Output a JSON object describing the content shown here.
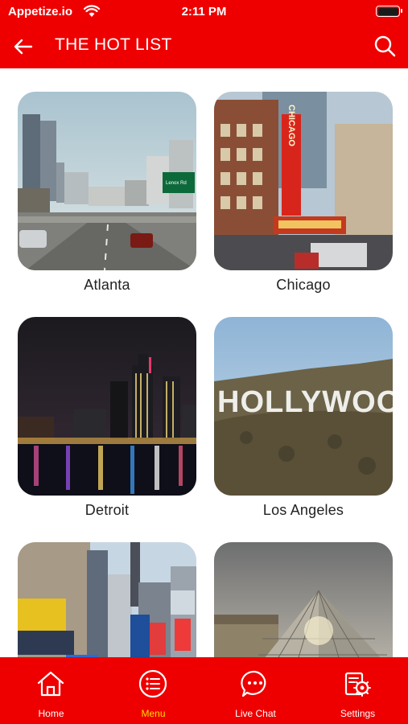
{
  "status_bar": {
    "carrier": "Appetize.io",
    "time": "2:11 PM"
  },
  "header": {
    "title": "THE HOT LIST"
  },
  "cities": [
    {
      "name": "Atlanta"
    },
    {
      "name": "Chicago"
    },
    {
      "name": "Detroit"
    },
    {
      "name": "Los Angeles"
    },
    {
      "name": ""
    },
    {
      "name": ""
    }
  ],
  "photo_text": {
    "chicago_sign": "CHICAGO",
    "hollywood_sign": "HOLLYWOOD"
  },
  "bottom_nav": {
    "items": [
      {
        "label": "Home",
        "icon": "home-icon"
      },
      {
        "label": "Menu",
        "icon": "menu-list-icon"
      },
      {
        "label": "Live Chat",
        "icon": "chat-bubble-icon"
      },
      {
        "label": "Settings",
        "icon": "settings-gear-icon"
      }
    ],
    "active_index": 1
  },
  "colors": {
    "brand_red": "#ee0000",
    "active_nav": "#ffde00",
    "text": "#222222"
  }
}
